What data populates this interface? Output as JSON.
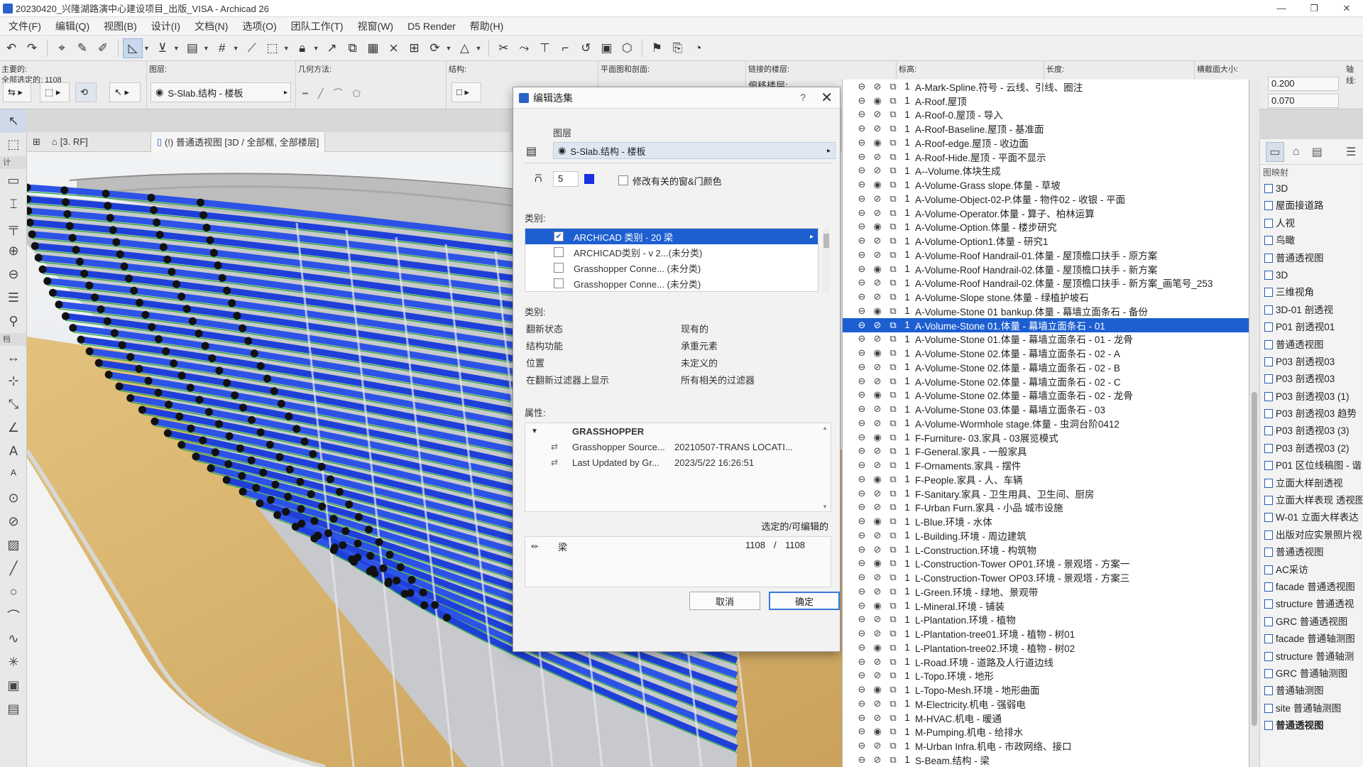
{
  "window": {
    "title": "20230420_兴隆湖路演中心建设项目_出版_VISA - Archicad 26",
    "min": "—",
    "max": "❐",
    "close": "✕"
  },
  "menu": [
    "文件(F)",
    "编辑(Q)",
    "视图(B)",
    "设计(I)",
    "文档(N)",
    "选项(O)",
    "团队工作(T)",
    "视窗(W)",
    "D5 Render",
    "帮助(H)"
  ],
  "infobox": {
    "main_label": "主要的:",
    "selected_count": "全部选定的: 1108",
    "layer_label": "图层:",
    "layer_value": "S-Slab.结构 - 楼板",
    "geometry_label": "几何方法:",
    "structure_label": "结构:",
    "plan_section_label": "平面图和剖面:",
    "linked_story_label": "链接的楼层:",
    "linked_story_sub": "偏移楼层:",
    "elevation_label": "标高:",
    "length_label": "长度:",
    "cross_section_label": "横截面大小:",
    "axis_label": "轴线:",
    "width_value": "0.200",
    "height_value": "0.070"
  },
  "viewtabs": {
    "story": "[3. RF]",
    "view3d": "(!) 普通透视图 [3D / 全部框, 全部楼层]"
  },
  "dialog": {
    "title": "编辑选集",
    "help": "?",
    "layer_section": "图层",
    "layer_value": "S-Slab.结构 - 楼板",
    "pen_value": "5",
    "modify_color_label": "修改有关的窗&门颜色",
    "classification_header": "类别:",
    "classes": [
      {
        "label": "ARCHICAD 类别 - 20  梁",
        "checked": true,
        "selected": true
      },
      {
        "label": "ARCHICAD类别 - v 2...(未分类)",
        "checked": false,
        "selected": false
      },
      {
        "label": "Grasshopper Conne... (未分类)",
        "checked": false,
        "selected": false
      },
      {
        "label": "Grasshopper Conne... (未分类)",
        "checked": false,
        "selected": false
      }
    ],
    "category_header": "类别:",
    "categories": [
      {
        "k": "翻新状态",
        "v": "现有的"
      },
      {
        "k": "结构功能",
        "v": "承重元素"
      },
      {
        "k": "位置",
        "v": "未定义的"
      },
      {
        "k": "在翻新过滤器上显示",
        "v": "所有相关的过滤器"
      }
    ],
    "properties_header": "属性:",
    "group_name": "GRASSHOPPER",
    "properties": [
      {
        "k": "Grasshopper Source...",
        "v": "20210507-TRANS LOCATI..."
      },
      {
        "k": "Last Updated by Gr...",
        "v": "2023/5/22 16:26:51"
      }
    ],
    "selected_editable_label": "选定的/可编辑的",
    "element_type": "梁",
    "selected_count": "1108",
    "slash": "/",
    "editable_count": "1108",
    "cancel": "取消",
    "ok": "确定"
  },
  "layers": [
    {
      "num": "1",
      "name": "A-Mark-Spline.符号 - 云线、引线、圈注"
    },
    {
      "num": "1",
      "name": "A-Roof.屋顶"
    },
    {
      "num": "1",
      "name": "A-Roof-0.屋顶 - 导入"
    },
    {
      "num": "1",
      "name": "A-Roof-Baseline.屋顶 - 基准面"
    },
    {
      "num": "1",
      "name": "A-Roof-edge.屋顶 - 收边面"
    },
    {
      "num": "1",
      "name": "A-Roof-Hide.屋顶 - 平面不显示"
    },
    {
      "num": "1",
      "name": "A--Volume.体块生成"
    },
    {
      "num": "1",
      "name": "A-Volume-Grass slope.体量 - 草坡"
    },
    {
      "num": "1",
      "name": "A-Volume-Object-02-P.体量 - 物件02 - 收银 - 平面"
    },
    {
      "num": "1",
      "name": "A-Volume-Operator.体量 - 算子、柏林运算"
    },
    {
      "num": "1",
      "name": "A-Volume-Option.体量 - 楼步研究"
    },
    {
      "num": "1",
      "name": "A-Volume-Option1.体量 - 研究1"
    },
    {
      "num": "1",
      "name": "A-Volume-Roof Handrail-01.体量 - 屋顶檐口扶手 - 原方案"
    },
    {
      "num": "1",
      "name": "A-Volume-Roof Handrail-02.体量 - 屋顶檐口扶手 - 新方案"
    },
    {
      "num": "1",
      "name": "A-Volume-Roof Handrail-02.体量 - 屋顶檐口扶手 - 新方案_画笔号_253"
    },
    {
      "num": "1",
      "name": "A-Volume-Slope stone.体量 - 绿植护坡石"
    },
    {
      "num": "1",
      "name": "A-Volume-Stone 01 bankup.体量 - 幕墙立面条石 - 备份"
    },
    {
      "num": "1",
      "name": "A-Volume-Stone 01.体量 - 幕墙立面条石 - 01",
      "selected": true
    },
    {
      "num": "1",
      "name": "A-Volume-Stone 01.体量 - 幕墙立面条石 - 01 - 龙骨"
    },
    {
      "num": "1",
      "name": "A-Volume-Stone 02.体量 - 幕墙立面条石 - 02 - A"
    },
    {
      "num": "1",
      "name": "A-Volume-Stone 02.体量 - 幕墙立面条石 - 02 - B"
    },
    {
      "num": "1",
      "name": "A-Volume-Stone 02.体量 - 幕墙立面条石 - 02 - C"
    },
    {
      "num": "1",
      "name": "A-Volume-Stone 02.体量 - 幕墙立面条石 - 02 - 龙骨"
    },
    {
      "num": "1",
      "name": "A-Volume-Stone 03.体量 - 幕墙立面条石 - 03"
    },
    {
      "num": "1",
      "name": "A-Volume-Wormhole stage.体量 - 虫洞台阶0412"
    },
    {
      "num": "1",
      "name": "F-Furniture- 03.家具 - 03展览模式"
    },
    {
      "num": "1",
      "name": "F-General.家具 - 一般家具"
    },
    {
      "num": "1",
      "name": "F-Ornaments.家具 - 摆件"
    },
    {
      "num": "1",
      "name": "F-People.家具 - 人、车辆"
    },
    {
      "num": "1",
      "name": "F-Sanitary.家具 - 卫生用具、卫生间、厨房"
    },
    {
      "num": "1",
      "name": "F-Urban Furn.家具 - 小品 城市设施"
    },
    {
      "num": "1",
      "name": "L-Blue.环境 - 水体"
    },
    {
      "num": "1",
      "name": "L-Building.环境 - 周边建筑"
    },
    {
      "num": "1",
      "name": "L-Construction.环境 - 构筑物"
    },
    {
      "num": "1",
      "name": "L-Construction-Tower OP01.环境 - 景观塔 - 方案一"
    },
    {
      "num": "1",
      "name": "L-Construction-Tower OP03.环境 - 景观塔 - 方案三"
    },
    {
      "num": "1",
      "name": "L-Green.环境 - 绿地、景观带"
    },
    {
      "num": "1",
      "name": "L-Mineral.环境 - 铺装"
    },
    {
      "num": "1",
      "name": "L-Plantation.环境 - 植物"
    },
    {
      "num": "1",
      "name": "L-Plantation-tree01.环境 - 植物 - 树01"
    },
    {
      "num": "1",
      "name": "L-Plantation-tree02.环境 - 植物 - 树02"
    },
    {
      "num": "1",
      "name": "L-Road.环境 - 道路及人行道边线"
    },
    {
      "num": "1",
      "name": "L-Topo.环境 - 地形"
    },
    {
      "num": "1",
      "name": "L-Topo-Mesh.环境 - 地形曲面"
    },
    {
      "num": "1",
      "name": "M-Electricity.机电 - 强弱电"
    },
    {
      "num": "1",
      "name": "M-HVAC.机电 - 暖通"
    },
    {
      "num": "1",
      "name": "M-Pumping.机电 - 给排水"
    },
    {
      "num": "1",
      "name": "M-Urban Infra.机电 - 市政网络、接口"
    },
    {
      "num": "1",
      "name": "S-Beam.结构 - 梁"
    }
  ],
  "navigator": {
    "header": "图映射",
    "items": [
      {
        "label": "3D"
      },
      {
        "label": "屋面接道路"
      },
      {
        "label": "人视"
      },
      {
        "label": "鸟瞰"
      },
      {
        "label": "普通透视图"
      },
      {
        "label": "3D"
      },
      {
        "label": "三维视角"
      },
      {
        "label": "3D-01 剖透视"
      },
      {
        "label": "P01 剖透视01"
      },
      {
        "label": "普通透视图"
      },
      {
        "label": "P03 剖透视03"
      },
      {
        "label": "P03 剖透视03"
      },
      {
        "label": "P03 剖透视03 (1)"
      },
      {
        "label": "P03 剖透视03 趋势"
      },
      {
        "label": "P03 剖透视03 (3)"
      },
      {
        "label": "P03 剖透视03 (2)"
      },
      {
        "label": "P01 区位线稿图 - 谐"
      },
      {
        "label": "立面大样剖透视"
      },
      {
        "label": "立面大样表现 透视图"
      },
      {
        "label": "W-01 立面大样表达"
      },
      {
        "label": "出版对应实景照片视"
      },
      {
        "label": "普通透视图"
      },
      {
        "label": "AC采访"
      },
      {
        "label": "facade 普通透视图"
      },
      {
        "label": "structure 普通透视"
      },
      {
        "label": "GRC 普通透视图"
      },
      {
        "label": "facade 普通轴测图"
      },
      {
        "label": "structure 普通轴测"
      },
      {
        "label": "GRC 普通轴测图"
      },
      {
        "label": "普通轴测图"
      },
      {
        "label": "site 普通轴测图"
      },
      {
        "label": "普通透视图",
        "bold": true
      }
    ]
  },
  "colors": {
    "accent": "#1d5fd1",
    "beam_blue": "#1e3fd8",
    "ground": "#d9b46a",
    "sky": "#e9ecef"
  }
}
